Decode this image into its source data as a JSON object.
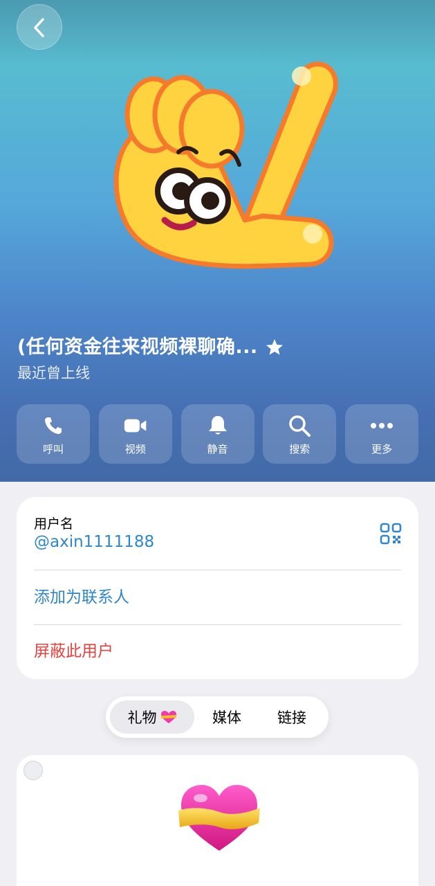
{
  "header": {
    "contact_name": "(任何资金往来视频裸聊确...",
    "status": "最近曾上线",
    "back_icon": "chevron-left-icon",
    "verified_icon": "star-icon"
  },
  "actions": [
    {
      "id": "call",
      "label": "呼叫",
      "icon": "phone-icon"
    },
    {
      "id": "video",
      "label": "视频",
      "icon": "video-camera-icon"
    },
    {
      "id": "mute",
      "label": "静音",
      "icon": "bell-icon"
    },
    {
      "id": "search",
      "label": "搜索",
      "icon": "search-icon"
    },
    {
      "id": "more",
      "label": "更多",
      "icon": "more-icon"
    }
  ],
  "info": {
    "username_label": "用户名",
    "username_value": "@axin1111188",
    "add_contact": "添加为联系人",
    "block_user": "屏蔽此用户"
  },
  "tabs": [
    {
      "label": "礼物",
      "active": true
    },
    {
      "label": "媒体",
      "active": false
    },
    {
      "label": "链接",
      "active": false
    }
  ],
  "colors": {
    "link_blue": "#2f86c8",
    "danger_red": "#e0443e",
    "gift_pink": "#f03aa9",
    "gift_ribbon": "#f5c321"
  }
}
